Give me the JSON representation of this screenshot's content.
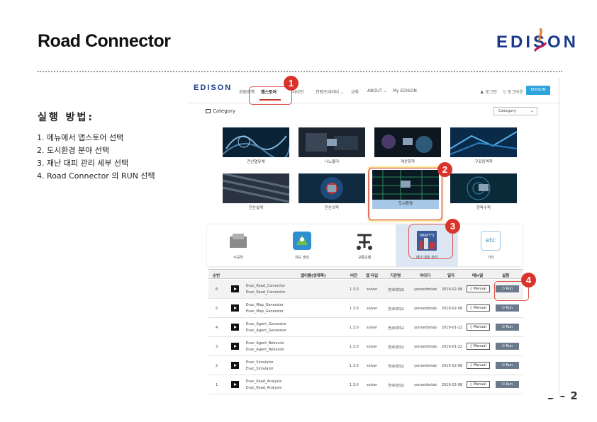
{
  "slide": {
    "title": "Road Connector",
    "logo_text": "EDISON",
    "steps_heading": "실행 방법:",
    "steps": [
      "1. 메뉴에서 앱스토어 선택",
      "2. 도시환경 분야 선택",
      "3. 재난 대피 관리 세부 선택",
      "4. Road Connector 의 RUN 선택"
    ],
    "page_number": "3 – 2"
  },
  "screenshot": {
    "nav": {
      "logo": "EDISON",
      "items": [
        "회원정책",
        "앱스토어",
        "사이언",
        "컨텐츠데이터 ⌄",
        "교육",
        "ABOUT ⌄",
        "My EDISON"
      ],
      "active_item": "앱스토어",
      "user_login": "로그인",
      "user_logout": "로그아웃",
      "cta_button": "EDISON"
    },
    "category": {
      "label": "Category",
      "select_value": "Category"
    },
    "tiles": [
      {
        "label": "전산열유체"
      },
      {
        "label": "나노물리"
      },
      {
        "label": "계산화학"
      },
      {
        "label": "구조동역학"
      },
      {
        "label": "전산설계"
      },
      {
        "label": "전산의학"
      },
      {
        "label": "도시환경"
      },
      {
        "label": "전파수학"
      }
    ],
    "sub_categories": [
      {
        "label": "수공학"
      },
      {
        "label": "지도 생성"
      },
      {
        "label": "교통모델"
      },
      {
        "label": "재난 대피 관리"
      },
      {
        "label": "기타"
      }
    ],
    "etc_icon_text": "etc",
    "draft_icon_text": "DRAFT'S",
    "table": {
      "headers": [
        "순번",
        "앱이름(영제목)",
        "버전",
        "앱 타입",
        "기관명",
        "아이디",
        "일자",
        "매뉴얼",
        "실행"
      ],
      "rows": [
        {
          "no": "6",
          "name1": "Evac_Road_Connector",
          "name2": "Evac_Road_Connector",
          "version": "1.3.0",
          "type": "solver",
          "org": "연세대학교",
          "id": "yonseidmlab",
          "date": "2019-02-08"
        },
        {
          "no": "5",
          "name1": "Evac_Map_Generator",
          "name2": "Evac_Map_Generator",
          "version": "1.3.0",
          "type": "solver",
          "org": "연세대학교",
          "id": "yonseidmlab",
          "date": "2019-02-08"
        },
        {
          "no": "4",
          "name1": "Evac_Agent_Generator",
          "name2": "Evac_Agent_Generator",
          "version": "1.3.0",
          "type": "solver",
          "org": "연세대학교",
          "id": "yonseidmlab",
          "date": "2019-01-22"
        },
        {
          "no": "3",
          "name1": "Evac_Agent_Behavior",
          "name2": "Evac_Agent_Behavior",
          "version": "1.3.0",
          "type": "solver",
          "org": "연세대학교",
          "id": "yonseidmlab",
          "date": "2019-01-22"
        },
        {
          "no": "2",
          "name1": "Evac_Simulator",
          "name2": "Evac_Simulator",
          "version": "1.3.0",
          "type": "solver",
          "org": "연세대학교",
          "id": "yonseidmlab",
          "date": "2019-02-08"
        },
        {
          "no": "1",
          "name1": "Evac_Road_Analysis",
          "name2": "Evac_Road_Analysis",
          "version": "1.3.0",
          "type": "solver",
          "org": "연세대학교",
          "id": "yonseidmlab",
          "date": "2019-02-08"
        }
      ],
      "manual_label": "Manual",
      "run_label": "Run"
    }
  },
  "callouts": [
    "1",
    "2",
    "3",
    "4"
  ],
  "colors": {
    "brand_blue": "#1a3a8c",
    "callout_red": "#d9342b",
    "selected_highlight": "#f4d576",
    "run_button": "#6a7a8c",
    "cta_blue": "#2ea3dc"
  }
}
